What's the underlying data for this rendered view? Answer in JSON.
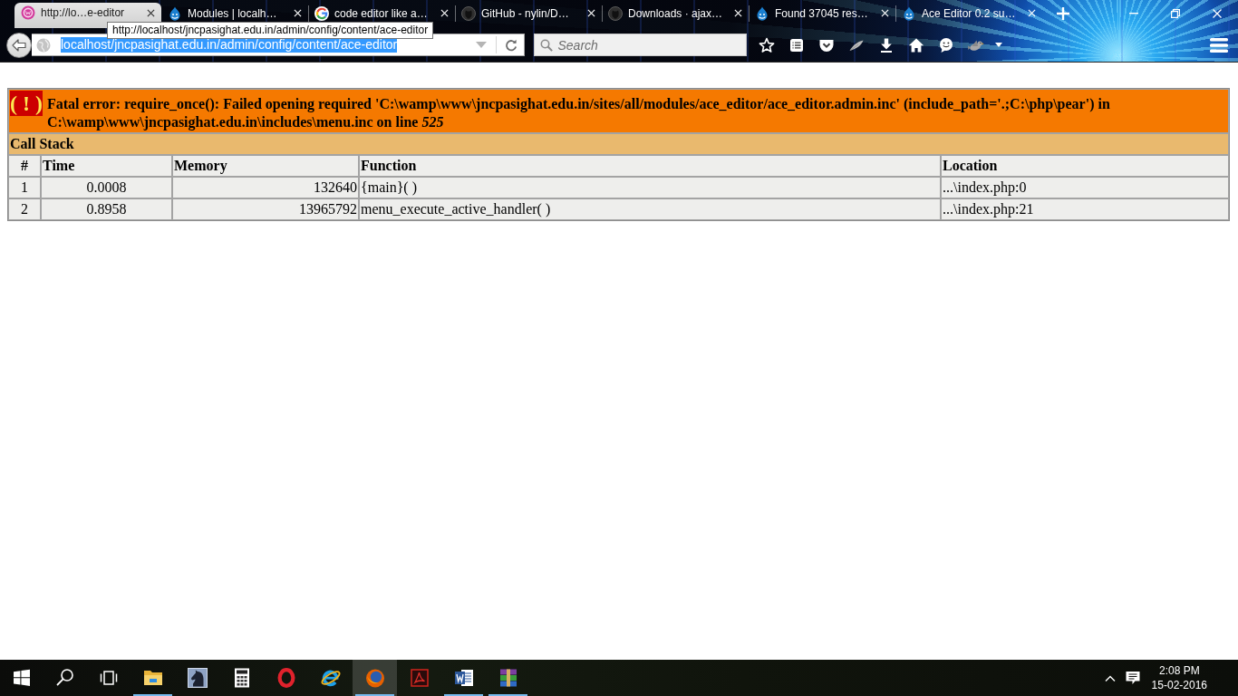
{
  "browser": {
    "tabs": [
      {
        "title": "http://lo…e-editor",
        "kind": "ring",
        "selected": true
      },
      {
        "title": "Modules | localh…",
        "kind": "drop",
        "selected": false
      },
      {
        "title": "code editor like a…",
        "kind": "g",
        "selected": false
      },
      {
        "title": "GitHub - nylin/D…",
        "kind": "cat",
        "selected": false
      },
      {
        "title": "Downloads · ajax…",
        "kind": "cat",
        "selected": false
      },
      {
        "title": "Found 37045 res…",
        "kind": "drop",
        "selected": false
      },
      {
        "title": "Ace Editor 0.2 su…",
        "kind": "drop",
        "selected": false
      }
    ],
    "tooltip": "http://localhost/jncpasighat.edu.in/admin/config/content/ace-editor",
    "address_bar": {
      "value": "localhost/jncpasighat.edu.in/admin/config/content/ace-editor",
      "selected": true
    },
    "search": {
      "placeholder": "Search"
    }
  },
  "page": {
    "error": {
      "badge": "( ! )",
      "message": "Fatal error: require_once(): Failed opening required 'C:\\wamp\\www\\jncpasighat.edu.in/sites/all/modules/ace_editor/ace_editor.admin.inc' (include_path='.;C:\\php\\pear') in C:\\wamp\\www\\jncpasighat.edu.in\\includes\\menu.inc on line *525*"
    },
    "call_stack": {
      "title": "Call Stack",
      "columns": [
        "#",
        "Time",
        "Memory",
        "Function",
        "Location"
      ],
      "rows": [
        [
          "1",
          "0.0008",
          "132640",
          "{main}( )",
          "...\\index.php:0"
        ],
        [
          "2",
          "0.8958",
          "13965792",
          "menu_execute_active_handler( )",
          "...\\index.php:21"
        ]
      ]
    }
  },
  "taskbar": {
    "apps": [
      {
        "kind": "folder",
        "running": true,
        "selected": false
      },
      {
        "kind": "horse",
        "running": false,
        "selected": false
      },
      {
        "kind": "calculator",
        "running": false,
        "selected": false
      },
      {
        "kind": "opera",
        "running": false,
        "selected": false
      },
      {
        "kind": "ie",
        "running": false,
        "selected": false
      },
      {
        "kind": "firefox",
        "running": true,
        "selected": true
      },
      {
        "kind": "pdf",
        "running": false,
        "selected": false
      },
      {
        "kind": "word",
        "running": true,
        "selected": false
      },
      {
        "kind": "archive",
        "running": true,
        "selected": false
      }
    ],
    "clock": {
      "time": "2:08 PM",
      "date": "15-02-2016"
    }
  }
}
